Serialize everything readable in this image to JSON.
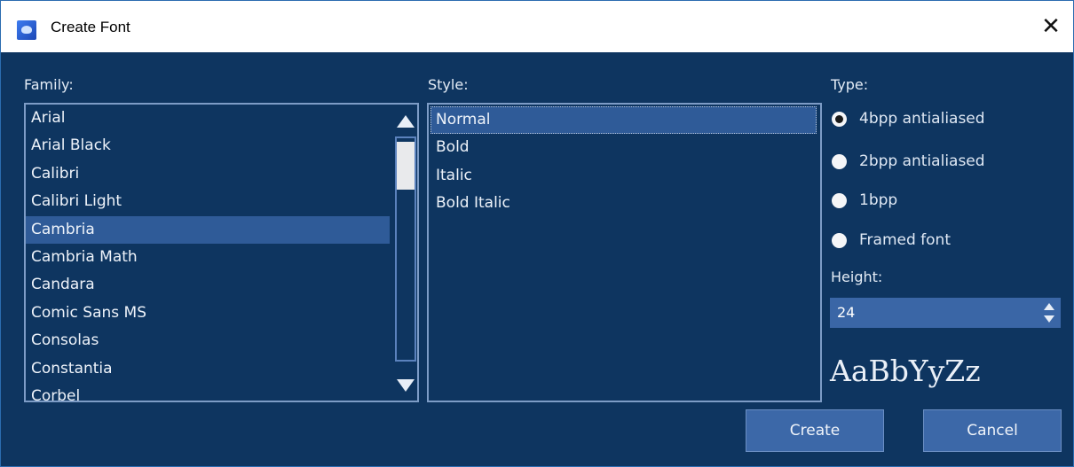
{
  "window": {
    "title": "Create Font",
    "close_glyph": "✕",
    "icon": "app-icon"
  },
  "family": {
    "label": "Family:",
    "items": [
      "Arial",
      "Arial Black",
      "Calibri",
      "Calibri Light",
      "Cambria",
      "Cambria Math",
      "Candara",
      "Comic Sans MS",
      "Consolas",
      "Constantia",
      "Corbel"
    ],
    "selected": "Cambria"
  },
  "style": {
    "label": "Style:",
    "items": [
      "Normal",
      "Bold",
      "Italic",
      "Bold Italic"
    ],
    "selected": "Normal"
  },
  "type": {
    "label": "Type:",
    "options": [
      "4bpp antialiased",
      "2bpp antialiased",
      "1bpp",
      "Framed font"
    ],
    "selected": "4bpp antialiased"
  },
  "height": {
    "label": "Height:",
    "value": "24"
  },
  "preview_text": "AaBbYyZz",
  "buttons": {
    "create": "Create",
    "cancel": "Cancel"
  },
  "colors": {
    "background": "#0e3560",
    "selection": "#2f5b98",
    "button": "#3c68a8"
  }
}
